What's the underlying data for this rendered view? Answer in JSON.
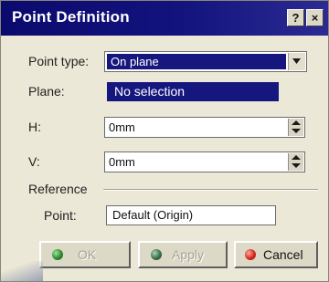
{
  "window": {
    "title": "Point Definition",
    "help_label": "?",
    "close_label": "×"
  },
  "form": {
    "point_type": {
      "label": "Point type:",
      "value": "On plane"
    },
    "plane": {
      "label": "Plane:",
      "value": "No selection"
    },
    "h": {
      "label": "H:",
      "value": "0mm"
    },
    "v": {
      "label": "V:",
      "value": "0mm"
    },
    "reference": {
      "group_label": "Reference",
      "point_label": "Point:",
      "point_value": "Default (Origin)"
    }
  },
  "buttons": {
    "ok": {
      "label": "OK",
      "enabled": false,
      "dot_color": "#2f8a2f"
    },
    "apply": {
      "label": "Apply",
      "enabled": false,
      "dot_color": "#3c6e4a"
    },
    "cancel": {
      "label": "Cancel",
      "enabled": true,
      "dot_color": "#d42a1e"
    }
  },
  "colors": {
    "title_bar": "#0a0a6e",
    "selection": "#16167f",
    "dialog_bg": "#ece8d7"
  }
}
